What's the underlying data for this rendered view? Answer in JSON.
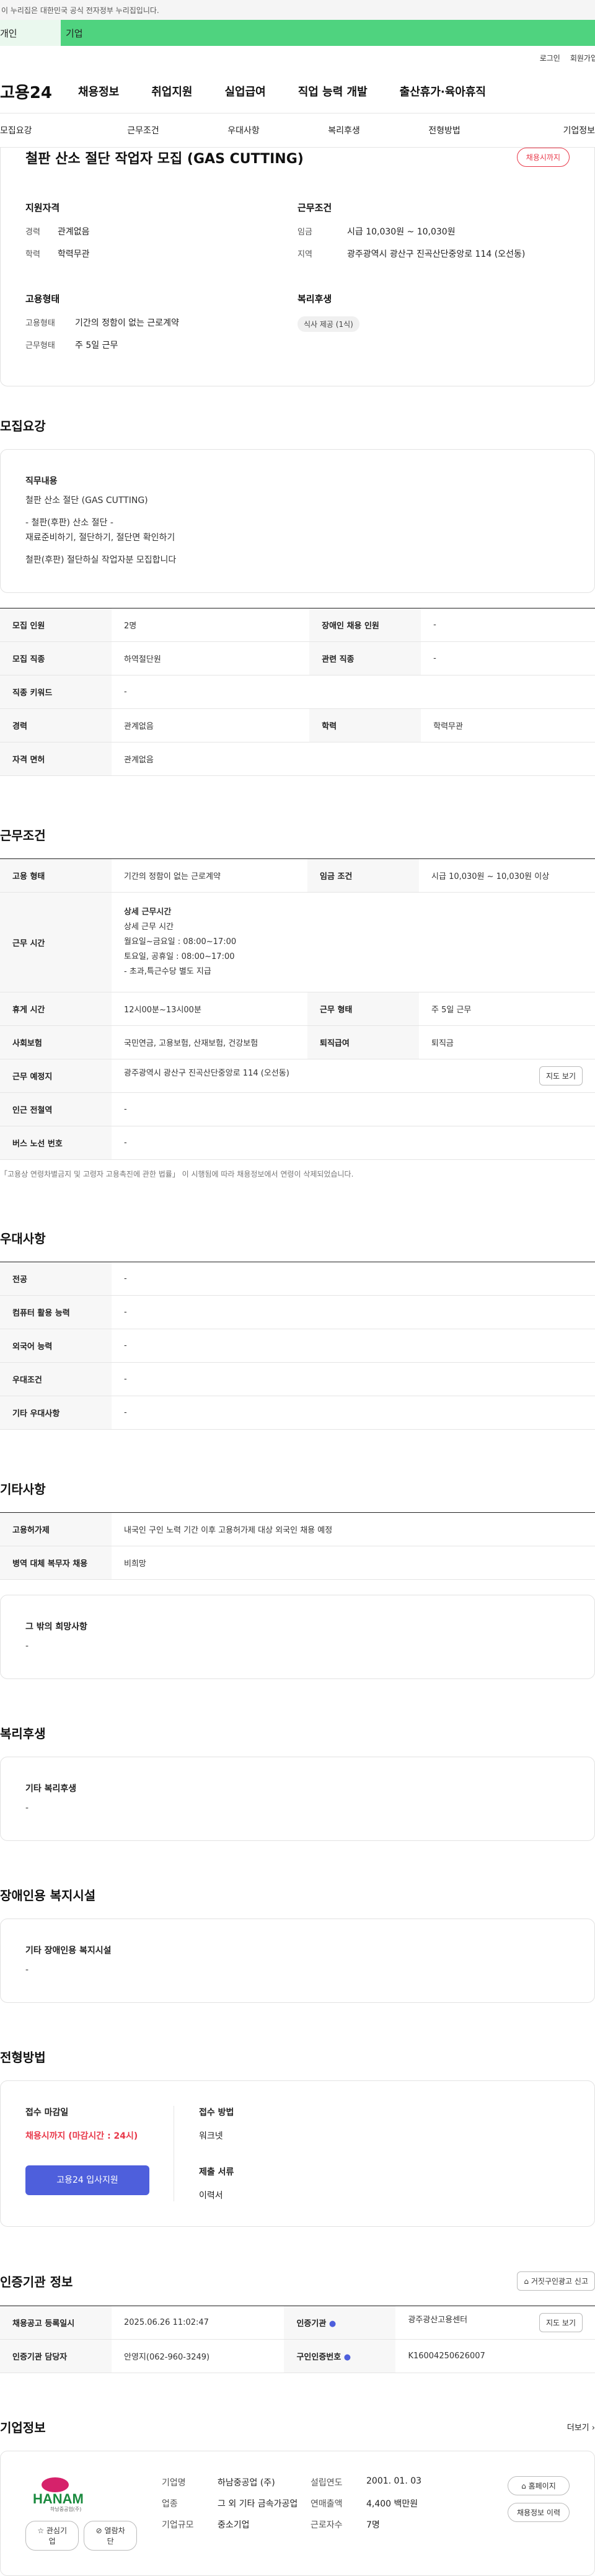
{
  "gov_banner": "이 누리집은 대한민국 공식 전자정부 누리집입니다.",
  "tabs": {
    "a": "개인",
    "b": "기업"
  },
  "util": {
    "login": "로그인",
    "join": "회원가입"
  },
  "gnb": {
    "logo": "고용24",
    "items": [
      "채용정보",
      "취업지원",
      "실업급여",
      "직업 능력 개발",
      "출산휴가·육아휴직"
    ]
  },
  "subnav": [
    "모집요강",
    "근무조건",
    "우대사항",
    "복리후생",
    "전형방법",
    "기업정보"
  ],
  "summary": {
    "title": "철판 산소 절단 작업자 모집 (GAS CUTTING)",
    "badge": "채용시까지",
    "qual_h": "지원자격",
    "career_k": "경력",
    "career_v": "관계없음",
    "edu_k": "학력",
    "edu_v": "학력무관",
    "cond_h": "근무조건",
    "wage_k": "임금",
    "wage_v": "시급 10,030원 ~ 10,030원",
    "loc_k": "지역",
    "loc_v": "광주광역시 광산구 진곡산단중앙로 114 (오선동)",
    "emp_h": "고용형태",
    "emptype_k": "고용형태",
    "emptype_v": "기간의 정함이 없는 근로계약",
    "worktype_k": "근무형태",
    "worktype_v": "주 5일 근무",
    "welfare_h": "복리후생",
    "welfare_chip": "식사 제공 (1식)"
  },
  "recruit": {
    "title": "모집요강",
    "duty_h": "직무내용",
    "duty_lines": [
      "철판 산소 절단 (GAS CUTTING)",
      "",
      "- 철판(후판) 산소 절단 -",
      "재료준비하기, 절단하기, 절단면 확인하기",
      "",
      "철판(후판) 절단하실 작업자분 모집합니다"
    ],
    "rows": [
      {
        "k1": "모집 인원",
        "v1": "2명",
        "k2": "장애인 채용 인원",
        "v2": "-"
      },
      {
        "k1": "모집 직종",
        "v1": "하역절단원",
        "k2": "관련 직종",
        "v2": "-"
      },
      {
        "k1": "직종 키워드",
        "v1": "-"
      },
      {
        "k1": "경력",
        "v1": "관계없음",
        "k2": "학력",
        "v2": "학력무관"
      },
      {
        "k1": "자격 면허",
        "v1": "관계없음"
      }
    ]
  },
  "conditions": {
    "title": "근무조건",
    "emp_k": "고용 형태",
    "emp_v": "기간의 정함이 없는 근로계약",
    "wage_k": "임금 조건",
    "wage_v": "시급 10,030원 ~ 10,030원 이상",
    "time_k": "근무 시간",
    "time_lines": [
      "상세 근무시간",
      "상세 근무 시간",
      "월요일~금요일 : 08:00~17:00",
      "토요일, 공휴일 : 08:00~17:00",
      "- 초과,특근수당 별도 지급"
    ],
    "rest_k": "휴게 시간",
    "rest_v": "12시00분~13시00분",
    "form_k": "근무 형태",
    "form_v": "주 5일 근무",
    "ins_k": "사회보험",
    "ins_v": "국민연금, 고용보험, 산재보험, 건강보험",
    "sev_k": "퇴직급여",
    "sev_v": "퇴직금",
    "place_k": "근무 예정지",
    "place_v": "광주광역시 광산구 진곡산단중앙로 114 (오선동)",
    "map_btn": "지도 보기",
    "sub_k": "인근 전철역",
    "sub_v": "-",
    "bus_k": "버스 노선 번호",
    "bus_v": "-",
    "note": "「고용상 연령차별금지 및 고령자 고용촉진에 관한 법률」 이 시행됨에 따라 채용정보에서 연령이 삭제되었습니다."
  },
  "preference": {
    "title": "우대사항",
    "rows": [
      {
        "k": "전공",
        "v": "-"
      },
      {
        "k": "컴퓨터 활용 능력",
        "v": "-"
      },
      {
        "k": "외국어 능력",
        "v": "-"
      },
      {
        "k": "우대조건",
        "v": "-"
      },
      {
        "k": "기타 우대사항",
        "v": "-"
      }
    ]
  },
  "etc": {
    "title": "기타사항",
    "rows": [
      {
        "k": "고용허가제",
        "v": "내국인 구인 노력 기간 이후 고용허가제 대상 외국인 채용 예정"
      },
      {
        "k": "병역 대체 복무자 채용",
        "v": "비희망"
      }
    ],
    "wish_h": "그 밖의 희망사항",
    "wish_v": "-"
  },
  "welfare": {
    "title": "복리후생",
    "h": "기타 복리후생",
    "v": "-"
  },
  "disabled": {
    "title": "장애인용 복지시설",
    "h": "기타 장애인용 복지시설",
    "v": "-"
  },
  "process": {
    "title": "전형방법",
    "deadline_h": "접수 마감일",
    "deadline_v": "채용시까지 (마감시간 : 24시)",
    "apply_btn": "고용24 입사지원",
    "method_h": "접수 방법",
    "method_v": "워크넷",
    "docs_h": "제출 서류",
    "docs_v": "이력서"
  },
  "cert": {
    "title": "인증기관 정보",
    "report_btn": "거짓구인광고 신고",
    "date_k": "채용공고 등록일시",
    "date_v": "2025.06.26 11:02:47",
    "org_k": "인증기관",
    "org_v": "광주광산고용센터",
    "map_btn": "지도 보기",
    "mgr_k": "인증기관 담당자",
    "mgr_v": "안영지(062-960-3249)",
    "no_k": "구인인증번호",
    "no_v": "K16004250626007"
  },
  "company": {
    "title": "기업정보",
    "more": "더보기",
    "logo_text": "HANAM",
    "logo_sub": "하남중공업(주)",
    "fav_btn": "관심기업",
    "block_btn": "열람차단",
    "name_k": "기업명",
    "name_v": "하남중공업 (주)",
    "ind_k": "업종",
    "ind_v": "그 외 기타 금속가공업",
    "size_k": "기업규모",
    "size_v": "중소기업",
    "year_k": "설립연도",
    "year_v": "2001. 01. 03",
    "sales_k": "연매출액",
    "sales_v": "4,400 백만원",
    "emp_k": "근로자수",
    "emp_v": "7명",
    "home_btn": "홈페이지",
    "hist_btn": "채용정보 이력"
  }
}
